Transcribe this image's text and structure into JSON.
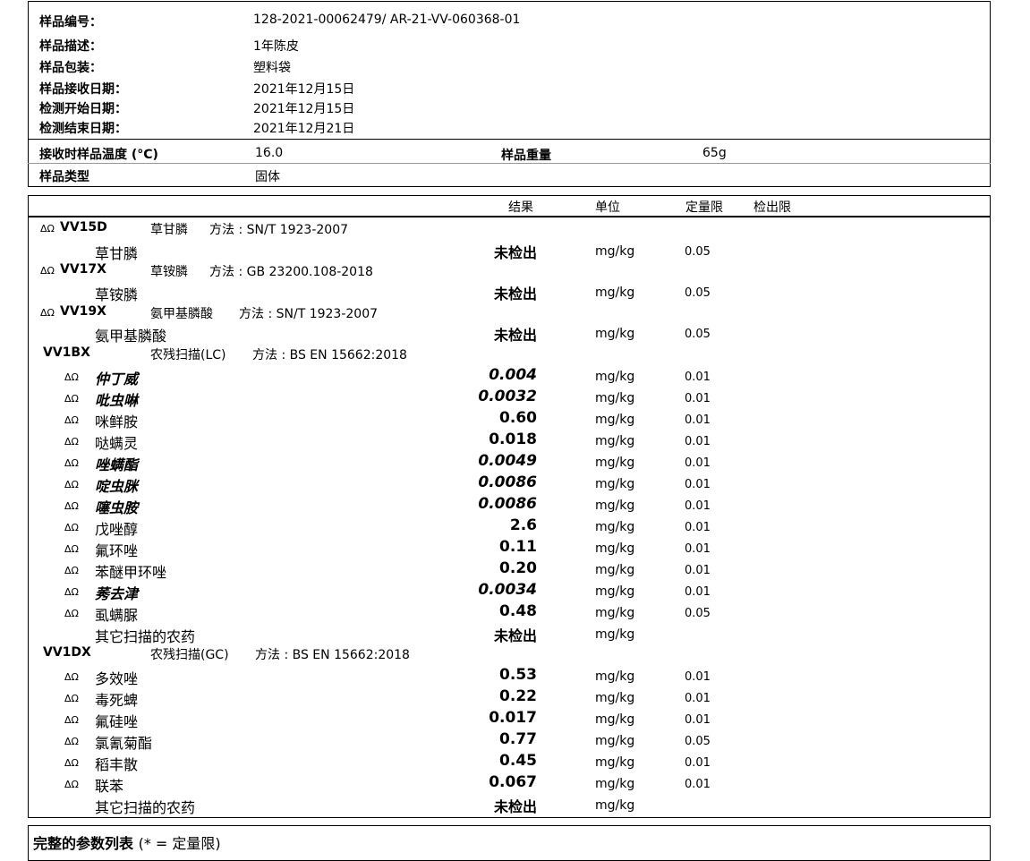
{
  "sample_info": {
    "fields": [
      {
        "label": "样品编号：",
        "value": "128-2021-00062479/   AR-21-VV-060368-01"
      },
      {
        "label": "样品描述：",
        "value": "1年陈皮"
      },
      {
        "label": "样品包装：",
        "value": "塑料袋"
      },
      {
        "label": "样品接收日期：",
        "value": "2021年12月15日"
      },
      {
        "label": "检测开始日期：",
        "value": "2021年12月15日"
      },
      {
        "label": "检测结束日期：",
        "value": "2021年12月21日"
      }
    ],
    "temp_label": "接收时样品温度 (°C)",
    "temp_value": "16.0",
    "weight_label": "样品重量",
    "weight_value": "65g",
    "type_label": "样品类型",
    "type_value": "固体"
  },
  "results_header": {
    "result": "结果",
    "unit": "单位",
    "loq": "定量限",
    "lod": "检出限"
  },
  "rows": [
    {
      "kind": "method",
      "marks": "ΔΩ",
      "code": "VV15D",
      "name": "草甘膦",
      "method": "方法 : SN/T 1923-2007"
    },
    {
      "kind": "analyte",
      "marks": "",
      "name": "草甘膦",
      "italic": false,
      "result": "未检出",
      "nd": true,
      "unit": "mg/kg",
      "loq": "0.05"
    },
    {
      "kind": "method",
      "marks": "ΔΩ",
      "code": "VV17X",
      "name": "草铵膦",
      "method": "方法 : GB 23200.108-2018"
    },
    {
      "kind": "analyte",
      "marks": "",
      "name": "草铵膦",
      "italic": false,
      "result": "未检出",
      "nd": true,
      "unit": "mg/kg",
      "loq": "0.05"
    },
    {
      "kind": "method",
      "marks": "ΔΩ",
      "code": "VV19X",
      "name": "氨甲基膦酸",
      "method": "方法 : SN/T 1923-2007"
    },
    {
      "kind": "analyte",
      "marks": "",
      "name": "氨甲基膦酸",
      "italic": false,
      "result": "未检出",
      "nd": true,
      "unit": "mg/kg",
      "loq": "0.05"
    },
    {
      "kind": "group",
      "code": "VV1BX",
      "name": "农残扫描(LC)",
      "method": "方法 : BS EN 15662:2018"
    },
    {
      "kind": "analyte",
      "marks": "ΔΩ",
      "name": "仲丁威",
      "italic": true,
      "result": "0.004",
      "nd": false,
      "unit": "mg/kg",
      "loq": "0.01"
    },
    {
      "kind": "analyte",
      "marks": "ΔΩ",
      "name": "吡虫啉",
      "italic": true,
      "result": "0.0032",
      "nd": false,
      "unit": "mg/kg",
      "loq": "0.01"
    },
    {
      "kind": "analyte",
      "marks": "ΔΩ",
      "name": "咪鲜胺",
      "italic": false,
      "result": "0.60",
      "nd": false,
      "unit": "mg/kg",
      "loq": "0.01"
    },
    {
      "kind": "analyte",
      "marks": "ΔΩ",
      "name": "哒螨灵",
      "italic": false,
      "result": "0.018",
      "nd": false,
      "unit": "mg/kg",
      "loq": "0.01"
    },
    {
      "kind": "analyte",
      "marks": "ΔΩ",
      "name": "唑螨酯",
      "italic": true,
      "result": "0.0049",
      "nd": false,
      "unit": "mg/kg",
      "loq": "0.01"
    },
    {
      "kind": "analyte",
      "marks": "ΔΩ",
      "name": "啶虫脒",
      "italic": true,
      "result": "0.0086",
      "nd": false,
      "unit": "mg/kg",
      "loq": "0.01"
    },
    {
      "kind": "analyte",
      "marks": "ΔΩ",
      "name": "噻虫胺",
      "italic": true,
      "result": "0.0086",
      "nd": false,
      "unit": "mg/kg",
      "loq": "0.01"
    },
    {
      "kind": "analyte",
      "marks": "ΔΩ",
      "name": "戊唑醇",
      "italic": false,
      "result": "2.6",
      "nd": false,
      "unit": "mg/kg",
      "loq": "0.01"
    },
    {
      "kind": "analyte",
      "marks": "ΔΩ",
      "name": "氟环唑",
      "italic": false,
      "result": "0.11",
      "nd": false,
      "unit": "mg/kg",
      "loq": "0.01"
    },
    {
      "kind": "analyte",
      "marks": "ΔΩ",
      "name": "苯醚甲环唑",
      "italic": false,
      "result": "0.20",
      "nd": false,
      "unit": "mg/kg",
      "loq": "0.01"
    },
    {
      "kind": "analyte",
      "marks": "ΔΩ",
      "name": "莠去津",
      "italic": true,
      "result": "0.0034",
      "nd": false,
      "unit": "mg/kg",
      "loq": "0.01"
    },
    {
      "kind": "analyte",
      "marks": "ΔΩ",
      "name": "虱螨脲",
      "italic": false,
      "result": "0.48",
      "nd": false,
      "unit": "mg/kg",
      "loq": "0.05"
    },
    {
      "kind": "analyte",
      "marks": "",
      "name": "其它扫描的农药",
      "italic": false,
      "result": "未检出",
      "nd": true,
      "unit": "mg/kg",
      "loq": ""
    },
    {
      "kind": "group",
      "code": "VV1DX",
      "name": "农残扫描(GC)",
      "method": "方法 : BS EN 15662:2018"
    },
    {
      "kind": "analyte",
      "marks": "ΔΩ",
      "name": "多效唑",
      "italic": false,
      "result": "0.53",
      "nd": false,
      "unit": "mg/kg",
      "loq": "0.01"
    },
    {
      "kind": "analyte",
      "marks": "ΔΩ",
      "name": "毒死蜱",
      "italic": false,
      "result": "0.22",
      "nd": false,
      "unit": "mg/kg",
      "loq": "0.01"
    },
    {
      "kind": "analyte",
      "marks": "ΔΩ",
      "name": "氟硅唑",
      "italic": false,
      "result": "0.017",
      "nd": false,
      "unit": "mg/kg",
      "loq": "0.01"
    },
    {
      "kind": "analyte",
      "marks": "ΔΩ",
      "name": "氯氰菊酯",
      "italic": false,
      "result": "0.77",
      "nd": false,
      "unit": "mg/kg",
      "loq": "0.05"
    },
    {
      "kind": "analyte",
      "marks": "ΔΩ",
      "name": "稻丰散",
      "italic": false,
      "result": "0.45",
      "nd": false,
      "unit": "mg/kg",
      "loq": "0.01"
    },
    {
      "kind": "analyte",
      "marks": "ΔΩ",
      "name": "联苯",
      "italic": false,
      "result": "0.067",
      "nd": false,
      "unit": "mg/kg",
      "loq": "0.01"
    },
    {
      "kind": "analyte",
      "marks": "",
      "name": "其它扫描的农药",
      "italic": false,
      "result": "未检出",
      "nd": true,
      "unit": "mg/kg",
      "loq": ""
    }
  ],
  "footer": {
    "title": "完整的参数列表",
    "note": "(* = 定量限)"
  }
}
